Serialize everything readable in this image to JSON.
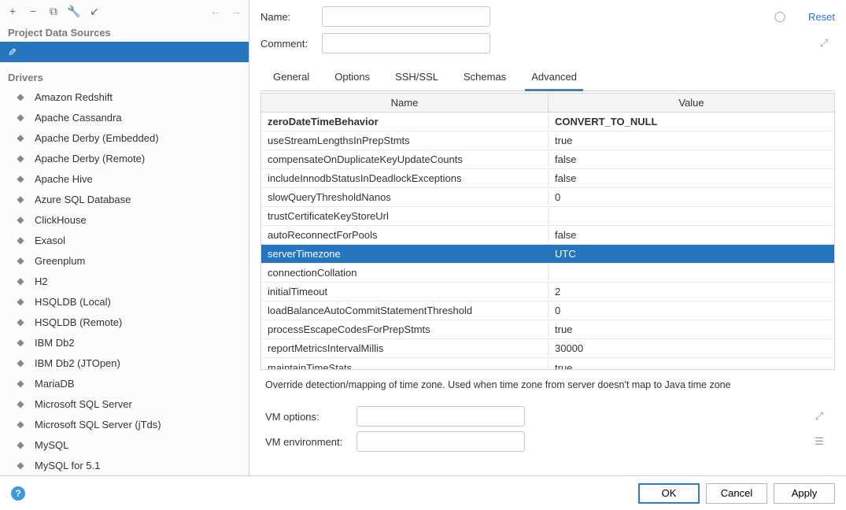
{
  "sidebar": {
    "ds_header": "Project Data Sources",
    "drivers_header": "Drivers",
    "drivers": [
      {
        "label": "Amazon Redshift",
        "icon": "db-icon"
      },
      {
        "label": "Apache Cassandra",
        "icon": "eye-icon"
      },
      {
        "label": "Apache Derby (Embedded)",
        "icon": "feather-icon"
      },
      {
        "label": "Apache Derby (Remote)",
        "icon": "feather-icon"
      },
      {
        "label": "Apache Hive",
        "icon": "hive-icon"
      },
      {
        "label": "Azure SQL Database",
        "icon": "azure-icon"
      },
      {
        "label": "ClickHouse",
        "icon": "bars-icon"
      },
      {
        "label": "Exasol",
        "icon": "x-icon"
      },
      {
        "label": "Greenplum",
        "icon": "circle-icon"
      },
      {
        "label": "H2",
        "icon": "h2-icon"
      },
      {
        "label": "HSQLDB (Local)",
        "icon": "gear-icon"
      },
      {
        "label": "HSQLDB (Remote)",
        "icon": "gear-icon"
      },
      {
        "label": "IBM Db2",
        "icon": "db-icon"
      },
      {
        "label": "IBM Db2 (JTOpen)",
        "icon": "db-icon"
      },
      {
        "label": "MariaDB",
        "icon": "seal-icon"
      },
      {
        "label": "Microsoft SQL Server",
        "icon": "mssql-icon"
      },
      {
        "label": "Microsoft SQL Server (jTds)",
        "icon": "mssql-icon"
      },
      {
        "label": "MySQL",
        "icon": "feather-icon"
      },
      {
        "label": "MySQL for 5.1",
        "icon": "feather-icon"
      }
    ]
  },
  "form": {
    "name_label": "Name:",
    "name_value": "",
    "comment_label": "Comment:",
    "comment_value": "",
    "reset_label": "Reset",
    "tabs": [
      "General",
      "Options",
      "SSH/SSL",
      "Schemas",
      "Advanced"
    ],
    "active_tab": 4,
    "table_headers": {
      "name": "Name",
      "value": "Value"
    },
    "properties": [
      {
        "name": "zeroDateTimeBehavior",
        "value": "CONVERT_TO_NULL",
        "bold": true
      },
      {
        "name": "useStreamLengthsInPrepStmts",
        "value": "true"
      },
      {
        "name": "compensateOnDuplicateKeyUpdateCounts",
        "value": "false"
      },
      {
        "name": "includeInnodbStatusInDeadlockExceptions",
        "value": "false"
      },
      {
        "name": "slowQueryThresholdNanos",
        "value": "0"
      },
      {
        "name": "trustCertificateKeyStoreUrl",
        "value": ""
      },
      {
        "name": "autoReconnectForPools",
        "value": "false"
      },
      {
        "name": "serverTimezone",
        "value": " UTC",
        "selected": true
      },
      {
        "name": "connectionCollation",
        "value": ""
      },
      {
        "name": "initialTimeout",
        "value": "2"
      },
      {
        "name": "loadBalanceAutoCommitStatementThreshold",
        "value": "0"
      },
      {
        "name": "processEscapeCodesForPrepStmts",
        "value": "true"
      },
      {
        "name": "reportMetricsIntervalMillis",
        "value": "30000"
      },
      {
        "name": "maintainTimeStats",
        "value": "true"
      }
    ],
    "hint": "Override detection/mapping of time zone. Used when time zone from server doesn't map to Java time zone",
    "vm_options_label": "VM options:",
    "vm_options_value": "",
    "vm_env_label": "VM environment:",
    "vm_env_value": ""
  },
  "footer": {
    "ok": "OK",
    "cancel": "Cancel",
    "apply": "Apply"
  }
}
